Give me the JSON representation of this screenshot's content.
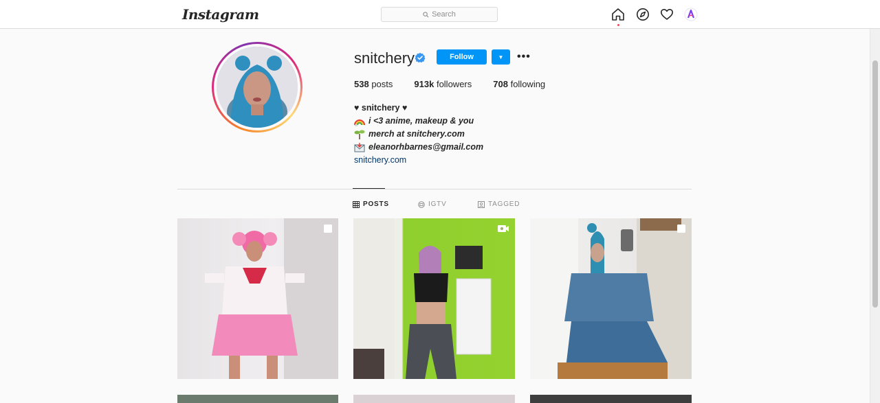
{
  "nav": {
    "logo": "Instagram",
    "search_placeholder": "Search"
  },
  "profile": {
    "username": "snitchery",
    "follow_label": "Follow",
    "more_label": "•••",
    "stats": {
      "posts_count": "538",
      "posts_label": "posts",
      "followers_count": "913k",
      "followers_label": "followers",
      "following_count": "708",
      "following_label": "following"
    },
    "bio": {
      "name_line": "♥ snitchery ♥",
      "line2": "i <3 anime, makeup & you",
      "line3": "merch at snitchery.com",
      "line4": "eleanorhbarnes@gmail.com",
      "link": "snitchery.com"
    }
  },
  "tabs": {
    "posts": "POSTS",
    "igtv": "IGTV",
    "tagged": "TAGGED"
  },
  "posts": [
    {
      "badge": "multiple-icon"
    },
    {
      "badge": "video-icon"
    },
    {
      "badge": "multiple-icon"
    }
  ],
  "colors": {
    "accent": "#0095f6",
    "notification_dot": "#ed4956"
  }
}
